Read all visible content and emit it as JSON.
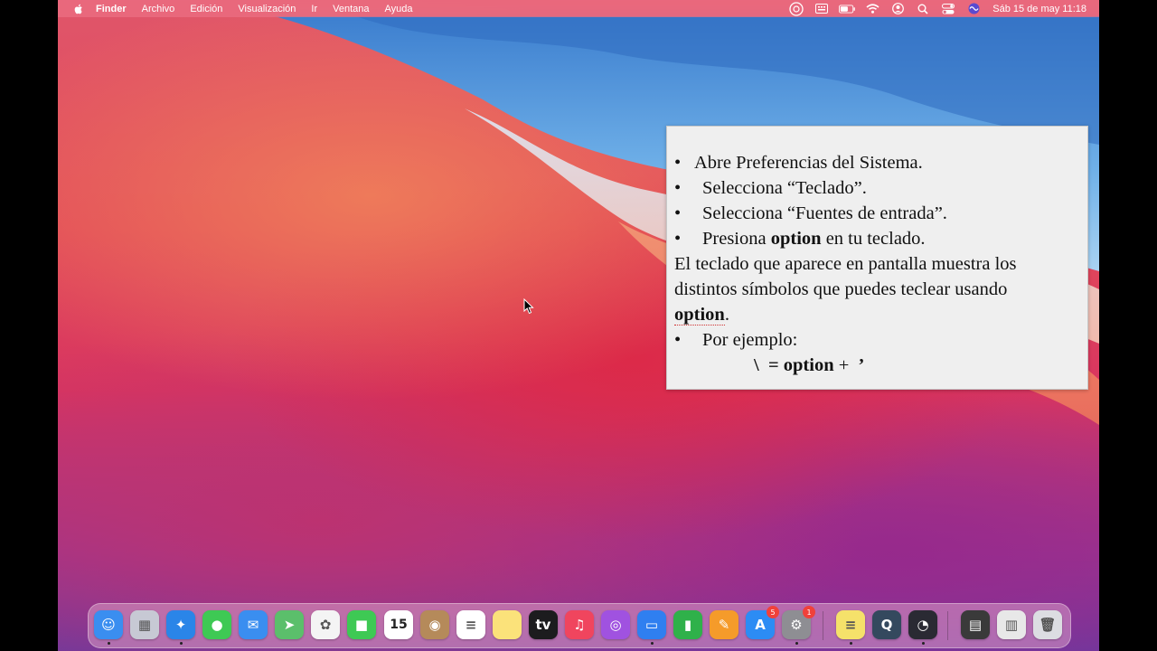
{
  "menubar": {
    "app_name": "Finder",
    "items": [
      "Archivo",
      "Edición",
      "Visualización",
      "Ir",
      "Ventana",
      "Ayuda"
    ],
    "status_icons": [
      "accessibility-icon",
      "keyboard-viewer-icon",
      "battery-icon",
      "wifi-icon",
      "user-icon",
      "spotlight-icon",
      "control-center-icon",
      "siri-icon"
    ],
    "clock": "Sáb 15 de may  11:18"
  },
  "slide": {
    "line1": "Abre Preferencias del Sistema.",
    "line2": "Selecciona “Teclado”.",
    "line3": "Selecciona “Fuentes de entrada”.",
    "line4_pre": "Presiona ",
    "line4_bold": "option",
    "line4_post": " en tu teclado.",
    "para1": "El teclado que aparece en pantalla muestra los",
    "para2": "distintos símbolos que puedes teclear usando",
    "para3_bold": "option",
    "para3_post": ".",
    "line5": "Por ejemplo:",
    "example_key": "\\",
    "example_eq": "=",
    "example_mod": "option",
    "example_plus": "+",
    "example_char": "’",
    "bullet": "•"
  },
  "dock": {
    "apps": [
      {
        "name": "Finder",
        "icon": "finder-icon",
        "color": "#3a8ef0",
        "glyph": "☺",
        "running": true
      },
      {
        "name": "Launchpad",
        "icon": "launchpad-icon",
        "color": "#c7c9d4",
        "glyph": "▦",
        "running": false
      },
      {
        "name": "Safari",
        "icon": "safari-icon",
        "color": "#2a85e8",
        "glyph": "✦",
        "running": true
      },
      {
        "name": "Mensajes",
        "icon": "messages-icon",
        "color": "#3ec954",
        "glyph": "●",
        "running": false
      },
      {
        "name": "Mail",
        "icon": "mail-icon",
        "color": "#3a8ef0",
        "glyph": "✉",
        "running": false
      },
      {
        "name": "Mapas",
        "icon": "maps-icon",
        "color": "#5bbf6b",
        "glyph": "➤",
        "running": false
      },
      {
        "name": "Fotos",
        "icon": "photos-icon",
        "color": "#f4f4f4",
        "glyph": "✿",
        "running": false
      },
      {
        "name": "FaceTime",
        "icon": "facetime-icon",
        "color": "#3ec954",
        "glyph": "■",
        "running": false
      },
      {
        "name": "Calendario",
        "icon": "calendar-icon",
        "color": "#ffffff",
        "glyph": "15",
        "running": false
      },
      {
        "name": "Contactos",
        "icon": "contacts-icon",
        "color": "#b58a5a",
        "glyph": "◉",
        "running": false
      },
      {
        "name": "Recordatorios",
        "icon": "reminders-icon",
        "color": "#ffffff",
        "glyph": "≡",
        "running": false
      },
      {
        "name": "Notas",
        "icon": "notes-icon",
        "color": "#fbe27a",
        "glyph": "",
        "running": false
      },
      {
        "name": "TV",
        "icon": "appletv-icon",
        "color": "#1c1c1e",
        "glyph": "tv",
        "running": false
      },
      {
        "name": "Música",
        "icon": "music-icon",
        "color": "#f0455e",
        "glyph": "♫",
        "running": false
      },
      {
        "name": "Podcasts",
        "icon": "podcasts-icon",
        "color": "#a052e0",
        "glyph": "◎",
        "running": false
      },
      {
        "name": "Keynote",
        "icon": "keynote-icon",
        "color": "#2f7ff0",
        "glyph": "▭",
        "running": true
      },
      {
        "name": "Numbers",
        "icon": "numbers-icon",
        "color": "#2fb14a",
        "glyph": "▮",
        "running": false
      },
      {
        "name": "Pages",
        "icon": "pages-icon",
        "color": "#f59b2a",
        "glyph": "✎",
        "running": false
      },
      {
        "name": "App Store",
        "icon": "appstore-icon",
        "color": "#2c8cf4",
        "glyph": "A",
        "running": false,
        "badge": "5"
      },
      {
        "name": "Preferencias del Sistema",
        "icon": "system-preferences-icon",
        "color": "#8e8e93",
        "glyph": "⚙",
        "running": true,
        "badge": "1"
      },
      {
        "name": "Notas adhesivas",
        "icon": "stickies-icon",
        "color": "#f5e16a",
        "glyph": "≡",
        "running": true
      },
      {
        "name": "QuickTime",
        "icon": "quicktime-icon",
        "color": "#34495e",
        "glyph": "Q",
        "running": false
      },
      {
        "name": "OBS",
        "icon": "obs-icon",
        "color": "#2a2a33",
        "glyph": "◔",
        "running": true
      },
      {
        "name": "Captura",
        "icon": "screenshot-folder-icon",
        "color": "#3a3a3a",
        "glyph": "▤",
        "running": false
      },
      {
        "name": "Imagen",
        "icon": "image-file-icon",
        "color": "#e8e8e8",
        "glyph": "▥",
        "running": false
      },
      {
        "name": "Papelera",
        "icon": "trash-icon",
        "color": "#dcdde2",
        "glyph": "🗑",
        "running": false
      }
    ]
  }
}
